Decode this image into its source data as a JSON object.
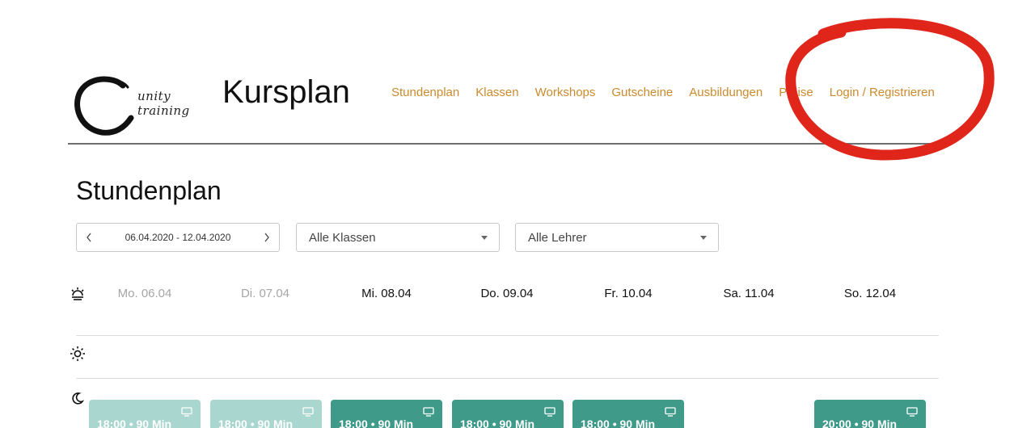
{
  "header": {
    "logo_text": "unity training",
    "page_title": "Kursplan",
    "nav": [
      "Stundenplan",
      "Klassen",
      "Workshops",
      "Gutscheine",
      "Ausbildungen",
      "Preise",
      "Login / Registrieren"
    ],
    "nav_color": "#cc8a2e"
  },
  "section_title": "Stundenplan",
  "filters": {
    "date_range": "06.04.2020 - 12.04.2020",
    "class_select": "Alle Klassen",
    "teacher_select": "Alle Lehrer"
  },
  "days": [
    {
      "label": "Mo. 06.04",
      "state": "past"
    },
    {
      "label": "Di. 07.04",
      "state": "past"
    },
    {
      "label": "Mi. 08.04",
      "state": "current"
    },
    {
      "label": "Do. 09.04",
      "state": "current"
    },
    {
      "label": "Fr. 10.04",
      "state": "current"
    },
    {
      "label": "Sa. 11.04",
      "state": "current"
    },
    {
      "label": "So. 12.04",
      "state": "current"
    }
  ],
  "period_icons": [
    "sunrise-icon",
    "sun-icon",
    "moon-icon"
  ],
  "evening_classes": [
    {
      "label": "18:00 • 90 Min",
      "day": "Mo. 06.04",
      "state": "past"
    },
    {
      "label": "18:00 • 90 Min",
      "day": "Di. 07.04",
      "state": "past"
    },
    {
      "label": "18:00 • 90 Min",
      "day": "Mi. 08.04",
      "state": "active"
    },
    {
      "label": "18:00 • 90 Min",
      "day": "Do. 09.04",
      "state": "active"
    },
    {
      "label": "18:00 • 90 Min",
      "day": "Fr. 10.04",
      "state": "active"
    },
    {
      "label": "20:00 • 90 Min",
      "day": "So. 12.04",
      "state": "active"
    }
  ],
  "colors": {
    "card_active": "#3f9a8a",
    "card_past": "#a9d6ce",
    "annotation": "#e0261b"
  }
}
